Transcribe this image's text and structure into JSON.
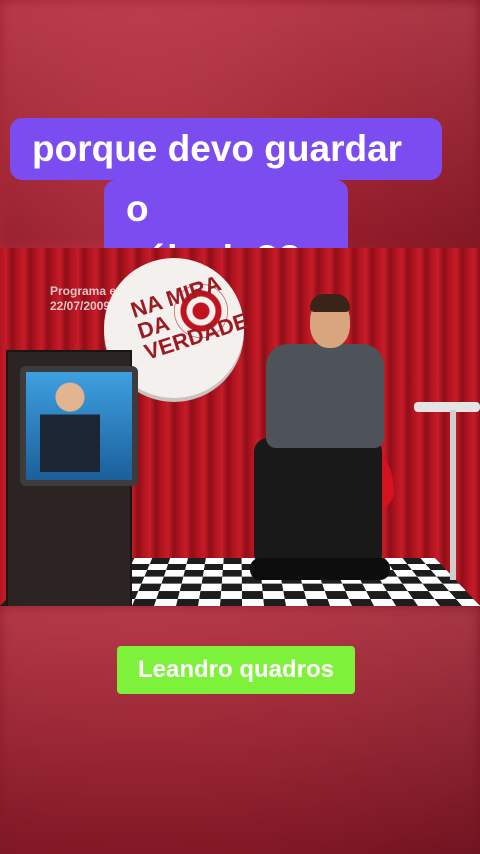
{
  "caption": {
    "line1": "porque devo guardar",
    "line2": "o sábado??"
  },
  "video": {
    "program_info_line1": "Programa exibido em",
    "program_info_line2": "22/07/2009",
    "logo_text": "NA MIRA DA VERDADE"
  },
  "name_badge": "Leandro quadros",
  "colors": {
    "caption_bg": "#7b4cf0",
    "name_badge_bg": "#7ef23a",
    "background_red": "#9e1e2c"
  }
}
